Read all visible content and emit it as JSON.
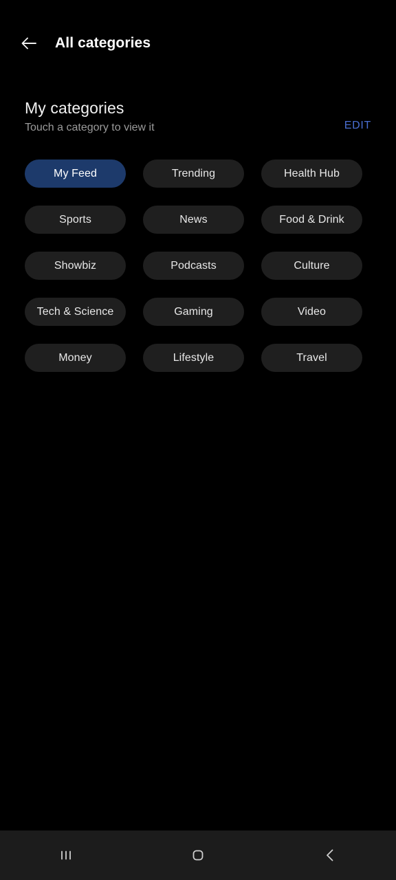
{
  "header": {
    "back_icon": "arrow-left-icon",
    "title": "All categories"
  },
  "section": {
    "title": "My categories",
    "subtitle": "Touch a category to view it",
    "edit_label": "EDIT",
    "edit_color": "#4a6fd4"
  },
  "theme": {
    "background": "#000000",
    "chip_background": "#1f1f1f",
    "chip_selected_background": "#1d3a6b",
    "chip_text": "#e8e8e8",
    "title_text": "#ffffff",
    "subtitle_text": "#9b9b9b",
    "nav_background": "#1c1c1c"
  },
  "categories": [
    {
      "label": "My Feed",
      "selected": true
    },
    {
      "label": "Trending",
      "selected": false
    },
    {
      "label": "Health Hub",
      "selected": false
    },
    {
      "label": "Sports",
      "selected": false
    },
    {
      "label": "News",
      "selected": false
    },
    {
      "label": "Food & Drink",
      "selected": false
    },
    {
      "label": "Showbiz",
      "selected": false
    },
    {
      "label": "Podcasts",
      "selected": false
    },
    {
      "label": "Culture",
      "selected": false
    },
    {
      "label": "Tech & Science",
      "selected": false
    },
    {
      "label": "Gaming",
      "selected": false
    },
    {
      "label": "Video",
      "selected": false
    },
    {
      "label": "Money",
      "selected": false
    },
    {
      "label": "Lifestyle",
      "selected": false
    },
    {
      "label": "Travel",
      "selected": false
    }
  ],
  "nav_bar": {
    "recents_icon": "recents-icon",
    "home_icon": "home-icon",
    "back_icon": "back-chevron-icon"
  }
}
